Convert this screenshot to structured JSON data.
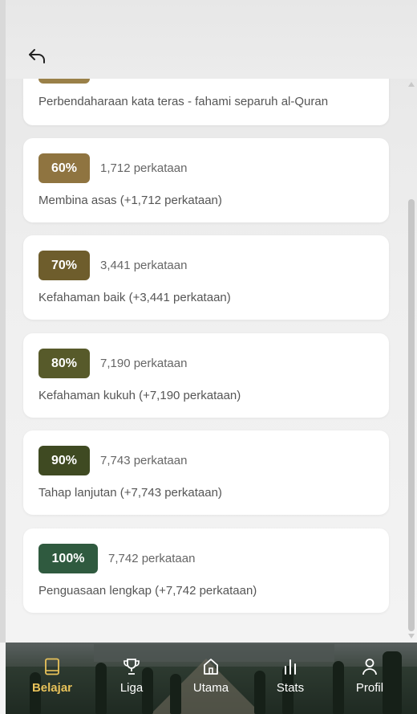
{
  "header": {
    "back_icon": "back-arrow-icon"
  },
  "levels": [
    {
      "percent": "",
      "count": "",
      "description": "Perbendaharaan kata teras - fahami separuh al-Quran",
      "color": "#9a8048"
    },
    {
      "percent": "60%",
      "count": "1,712 perkataan",
      "description": "Membina asas (+1,712 perkataan)",
      "color": "#8f7440"
    },
    {
      "percent": "70%",
      "count": "3,441 perkataan",
      "description": "Kefahaman baik (+3,441 perkataan)",
      "color": "#6e5d2c"
    },
    {
      "percent": "80%",
      "count": "7,190 perkataan",
      "description": "Kefahaman kukuh (+7,190 perkataan)",
      "color": "#575a2a"
    },
    {
      "percent": "90%",
      "count": "7,743 perkataan",
      "description": "Tahap lanjutan (+7,743 perkataan)",
      "color": "#3f4a22"
    },
    {
      "percent": "100%",
      "count": "7,742 perkataan",
      "description": "Penguasaan lengkap (+7,742 perkataan)",
      "color": "#2f5a3f"
    }
  ],
  "nav": {
    "items": [
      {
        "label": "Belajar",
        "icon": "book-icon",
        "active": true
      },
      {
        "label": "Liga",
        "icon": "trophy-icon",
        "active": false
      },
      {
        "label": "Utama",
        "icon": "home-icon",
        "active": false
      },
      {
        "label": "Stats",
        "icon": "bar-chart-icon",
        "active": false
      },
      {
        "label": "Profil",
        "icon": "user-icon",
        "active": false
      }
    ],
    "active_color": "#e8c25a"
  }
}
